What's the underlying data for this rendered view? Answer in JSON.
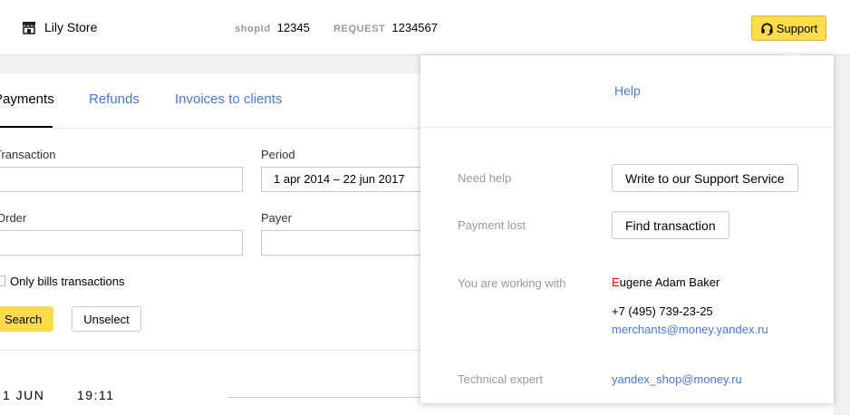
{
  "header": {
    "store_name": "Lily Store",
    "shopid_label": "shopId",
    "shopid_value": "12345",
    "request_label": "REQUEST",
    "request_value": "1234567",
    "support_label": "Support"
  },
  "tabs": [
    {
      "label": "Payments",
      "active": true
    },
    {
      "label": "Refunds",
      "active": false
    },
    {
      "label": "Invoices to clients",
      "active": false
    }
  ],
  "filters": {
    "transaction_label": "Transaction",
    "transaction_value": "",
    "period_label": "Period",
    "period_value": "1 apr 2014 – 22 jun 2017",
    "order_label": "Order",
    "order_value": "",
    "payer_label": "Payer",
    "payer_value": "",
    "only_bills_label": "Only bills transactions",
    "search_label": "Search",
    "unselect_label": "Unselect"
  },
  "list": {
    "date": "1 JUN",
    "time": "19:11"
  },
  "popup": {
    "help_label": "Help",
    "need_help_label": "Need help",
    "write_support_label": "Write to our Support Service",
    "payment_lost_label": "Payment lost",
    "find_transaction_label": "Find transaction",
    "working_with_label": "You are working with",
    "manager_initial": "E",
    "manager_rest": "ugene Adam Baker",
    "phone": "+7 (495) 739-23-25",
    "email": "merchants@money.yandex.ru",
    "tech_expert_label": "Technical expert",
    "tech_email": "yandex_shop@money.ru"
  },
  "colors": {
    "accent_yellow": "#ffdb4d",
    "link_blue": "#4a78c7",
    "label_gray": "#999999",
    "initial_red": "#ee0000"
  }
}
